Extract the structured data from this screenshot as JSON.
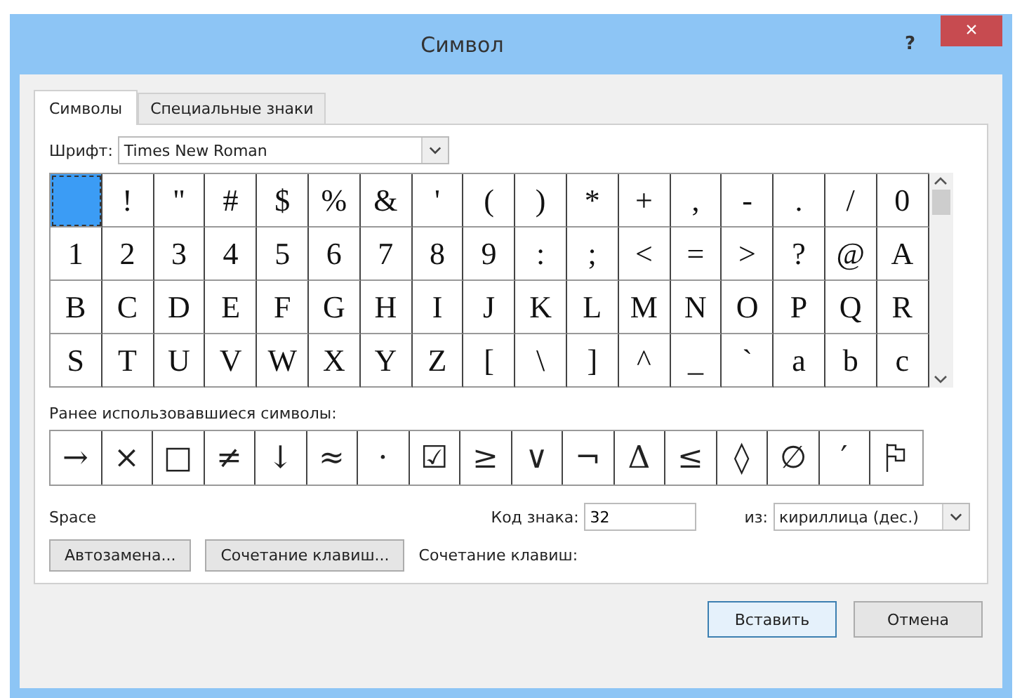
{
  "window": {
    "title": "Символ",
    "help": "?",
    "close": "×"
  },
  "tabs": [
    {
      "label": "Символы",
      "selected": true
    },
    {
      "label": "Специальные знаки",
      "selected": false
    }
  ],
  "font": {
    "label": "Шрифт:",
    "value": "Times New Roman"
  },
  "symbols": [
    {
      "selected": true
    },
    {
      "char": "!",
      "selected": false
    },
    {
      "char": "\"",
      "selected": false
    },
    {
      "char": "#",
      "selected": false
    },
    {
      "char": "$",
      "selected": false
    },
    {
      "char": "%",
      "selected": false
    },
    {
      "char": "&",
      "selected": false
    },
    {
      "char": "'",
      "selected": false
    },
    {
      "char": "(",
      "selected": false
    },
    {
      "char": ")",
      "selected": false
    },
    {
      "char": "*",
      "selected": false
    },
    {
      "char": "+",
      "selected": false
    },
    {
      "char": ",",
      "selected": false
    },
    {
      "char": "-",
      "selected": false
    },
    {
      "char": ".",
      "selected": false
    },
    {
      "char": "/",
      "selected": false
    },
    {
      "char": "0",
      "selected": false
    },
    {
      "char": "1",
      "selected": false
    },
    {
      "char": "2",
      "selected": false
    },
    {
      "char": "3",
      "selected": false
    },
    {
      "char": "4",
      "selected": false
    },
    {
      "char": "5",
      "selected": false
    },
    {
      "char": "6",
      "selected": false
    },
    {
      "char": "7",
      "selected": false
    },
    {
      "char": "8",
      "selected": false
    },
    {
      "char": "9",
      "selected": false
    },
    {
      "char": ":",
      "selected": false
    },
    {
      "char": ";",
      "selected": false
    },
    {
      "char": "<",
      "selected": false
    },
    {
      "char": "=",
      "selected": false
    },
    {
      "char": ">",
      "selected": false
    },
    {
      "char": "?",
      "selected": false
    },
    {
      "char": "@",
      "selected": false
    },
    {
      "char": "A",
      "selected": false
    },
    {
      "char": "B",
      "selected": false
    },
    {
      "char": "C",
      "selected": false
    },
    {
      "char": "D",
      "selected": false
    },
    {
      "char": "E",
      "selected": false
    },
    {
      "char": "F",
      "selected": false
    },
    {
      "char": "G",
      "selected": false
    },
    {
      "char": "H",
      "selected": false
    },
    {
      "char": "I",
      "selected": false
    },
    {
      "char": "J",
      "selected": false
    },
    {
      "char": "K",
      "selected": false
    },
    {
      "char": "L",
      "selected": false
    },
    {
      "char": "M",
      "selected": false
    },
    {
      "char": "N",
      "selected": false
    },
    {
      "char": "O",
      "selected": false
    },
    {
      "char": "P",
      "selected": false
    },
    {
      "char": "Q",
      "selected": false
    },
    {
      "char": "R",
      "selected": false
    },
    {
      "char": "S",
      "selected": false
    },
    {
      "char": "T",
      "selected": false
    },
    {
      "char": "U",
      "selected": false
    },
    {
      "char": "V",
      "selected": false
    },
    {
      "char": "W",
      "selected": false
    },
    {
      "char": "X",
      "selected": false
    },
    {
      "char": "Y",
      "selected": false
    },
    {
      "char": "Z",
      "selected": false
    },
    {
      "char": "[",
      "selected": false
    },
    {
      "char": "\\",
      "selected": false
    },
    {
      "char": "]",
      "selected": false
    },
    {
      "char": "^",
      "selected": false
    },
    {
      "char": "_",
      "selected": false
    },
    {
      "char": "`",
      "selected": false
    },
    {
      "char": "a",
      "selected": false
    },
    {
      "char": "b",
      "selected": false
    },
    {
      "char": "c",
      "selected": false
    }
  ],
  "recent_label": "Ранее использовавшиеся символы:",
  "recent": [
    {
      "kind": "char",
      "char": "→"
    },
    {
      "kind": "char",
      "char": "×"
    },
    {
      "kind": "char",
      "char": "□"
    },
    {
      "kind": "char",
      "char": "≠"
    },
    {
      "kind": "char",
      "char": "↓"
    },
    {
      "kind": "char",
      "char": "≈"
    },
    {
      "kind": "char",
      "char": "·"
    },
    {
      "kind": "char",
      "char": "☑"
    },
    {
      "kind": "char",
      "char": "≥"
    },
    {
      "kind": "char",
      "char": "∨"
    },
    {
      "kind": "char",
      "char": "¬"
    },
    {
      "kind": "char",
      "char": "Δ"
    },
    {
      "kind": "char",
      "char": "≤"
    },
    {
      "kind": "char",
      "char": "◊"
    },
    {
      "kind": "char",
      "char": "∅"
    },
    {
      "kind": "char",
      "char": "′"
    },
    {
      "kind": "flag"
    }
  ],
  "symbol_name": "Space",
  "code": {
    "label": "Код знака:",
    "value": "32"
  },
  "from": {
    "label": "из:",
    "value": "кириллица (дес.)"
  },
  "buttons": {
    "autocorrect": "Автозамена...",
    "shortcut": "Сочетание клавиш...",
    "shortcut_label": "Сочетание клавиш:",
    "insert": "Вставить",
    "cancel": "Отмена"
  }
}
